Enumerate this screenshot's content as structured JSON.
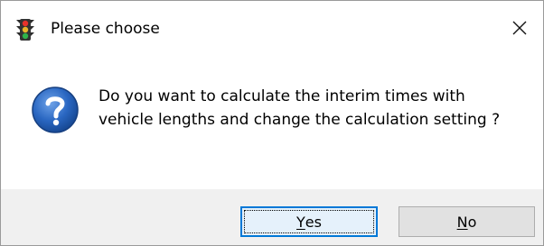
{
  "window": {
    "title": "Please choose",
    "app_icon": "traffic-light-icon",
    "close_icon": "close-icon",
    "close_symbol": "✕"
  },
  "message": {
    "icon": "question-icon",
    "line1": "Do you want to calculate the interim times with",
    "line2": "vehicle lengths and change the calculation setting ?"
  },
  "buttons": {
    "yes": {
      "mnemonic": "Y",
      "rest": "es"
    },
    "no": {
      "mnemonic": "N",
      "rest": "o"
    }
  },
  "colors": {
    "accent": "#0078d7",
    "question_icon": "#1f5fb7",
    "footer_bg": "#f0f0f0"
  }
}
